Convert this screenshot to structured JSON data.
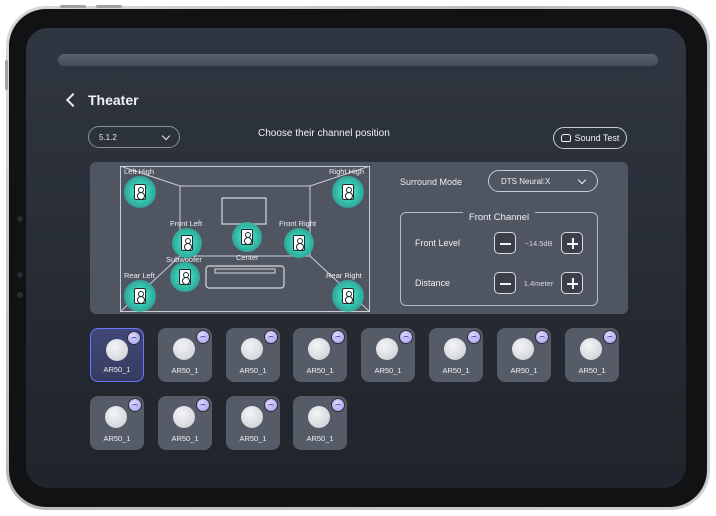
{
  "header": {
    "title": "Theater"
  },
  "preset": {
    "value": "5.1.2"
  },
  "choose_label": "Choose their channel position",
  "sound_test_label": "Sound Test",
  "speakers": [
    {
      "label": "Left High"
    },
    {
      "label": "Right High"
    },
    {
      "label": "Front Left"
    },
    {
      "label": "Front Right"
    },
    {
      "label": "Center"
    },
    {
      "label": "Subwoofer"
    },
    {
      "label": "Rear Left"
    },
    {
      "label": "Rear Right"
    }
  ],
  "surround": {
    "label": "Surround Mode",
    "value": "DTS Neural:X"
  },
  "front_channel": {
    "title": "Front Channel",
    "level": {
      "label": "Front Level",
      "value": "−14.5dB"
    },
    "distance": {
      "label": "Distance",
      "value": "1.4meter"
    }
  },
  "devices": [
    {
      "name": "AR50_1",
      "selected": true
    },
    {
      "name": "AR50_1"
    },
    {
      "name": "AR50_1"
    },
    {
      "name": "AR50_1"
    },
    {
      "name": "AR50_1"
    },
    {
      "name": "AR50_1"
    },
    {
      "name": "AR50_1"
    },
    {
      "name": "AR50_1"
    },
    {
      "name": "AR50_1"
    },
    {
      "name": "AR50_1"
    },
    {
      "name": "AR50_1"
    },
    {
      "name": "AR50_1"
    }
  ],
  "colors": {
    "speaker_glow": "#3fd1bb",
    "selected_border": "#6b74ff",
    "screen_bg": "#2a2f38"
  }
}
